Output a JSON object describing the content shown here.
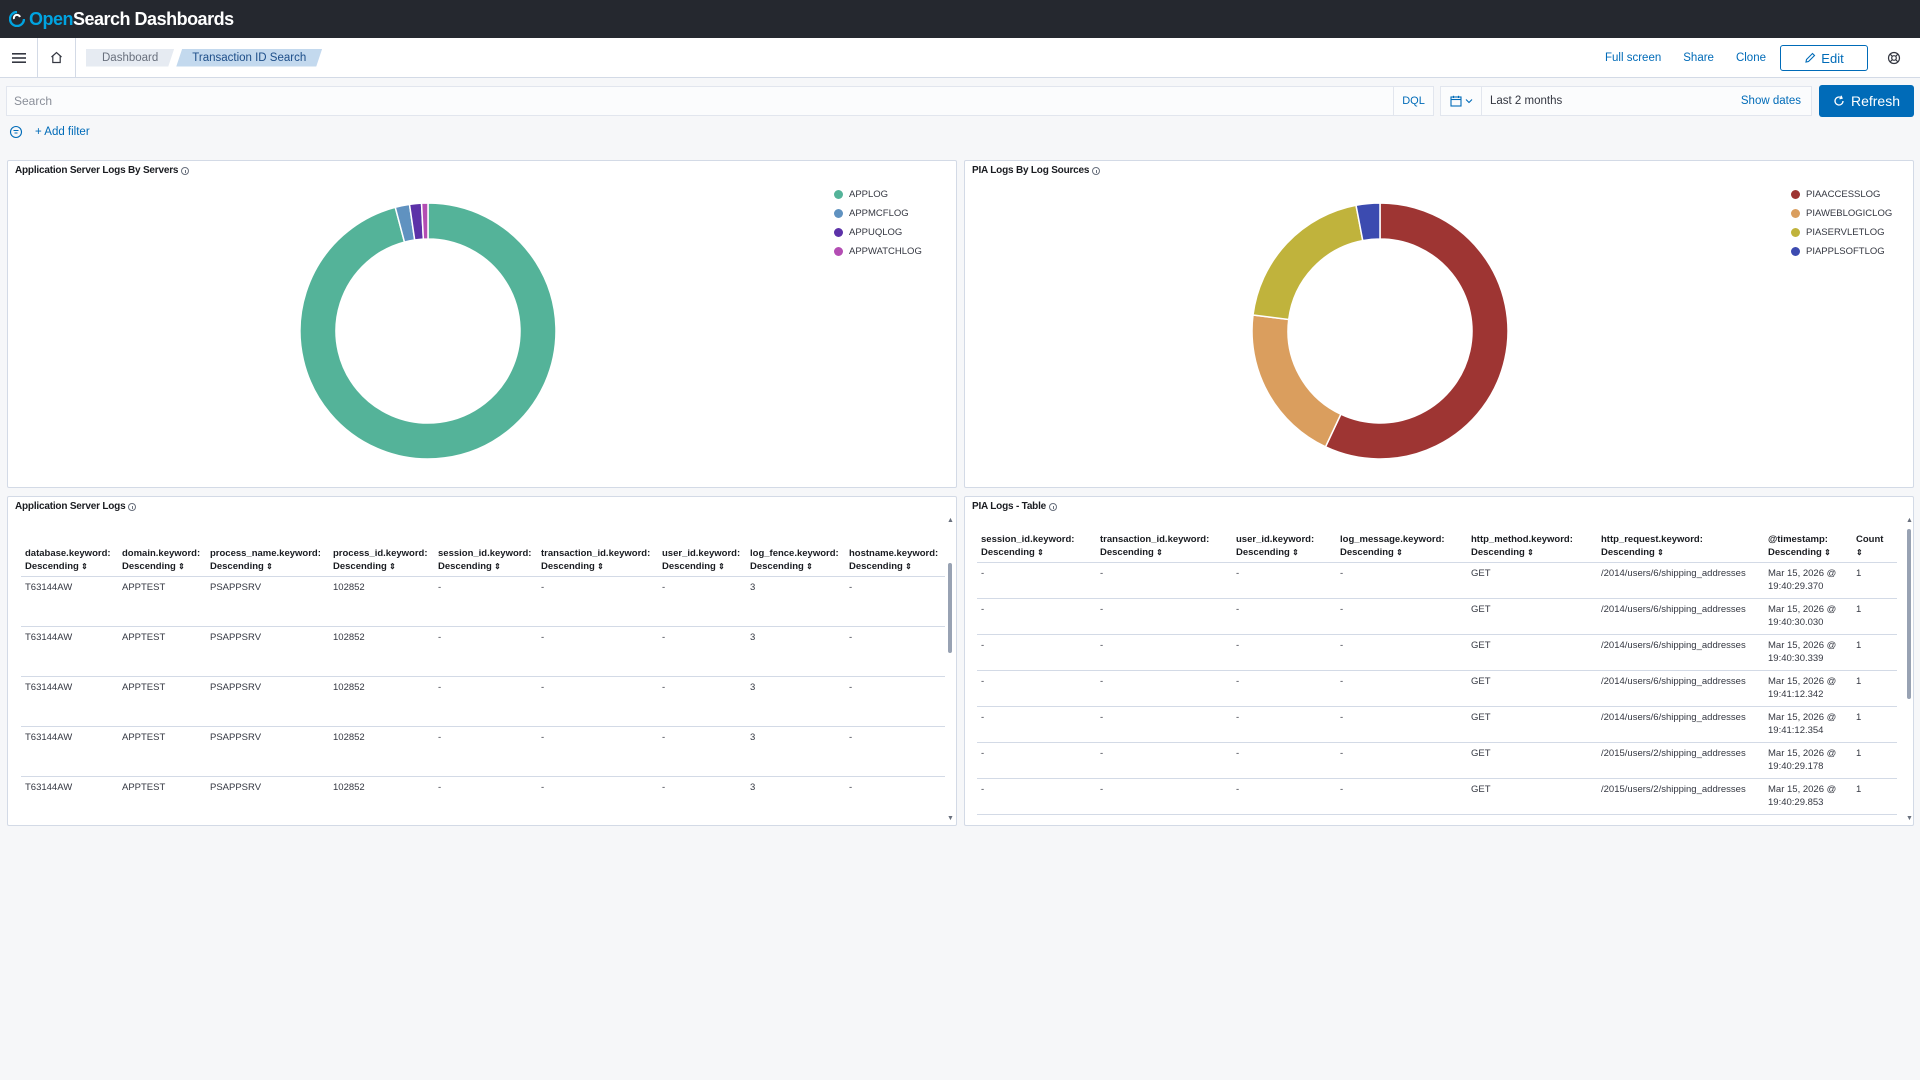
{
  "app": {
    "logo_open": "Open",
    "logo_rest": "Search Dashboards"
  },
  "breadcrumbs": [
    "Dashboard",
    "Transaction ID Search"
  ],
  "header_actions": {
    "fullscreen": "Full screen",
    "share": "Share",
    "clone": "Clone",
    "edit": "Edit"
  },
  "query": {
    "placeholder": "Search",
    "language": "DQL",
    "date_range": "Last 2 months",
    "show_dates": "Show dates",
    "refresh": "Refresh"
  },
  "filters": {
    "add_filter": "+ Add filter"
  },
  "panels": {
    "app_server_chart": {
      "title": "Application Server Logs By Servers",
      "legend": [
        {
          "label": "APPLOG",
          "color": "#54b399"
        },
        {
          "label": "APPMCFLOG",
          "color": "#6092c0"
        },
        {
          "label": "APPUQLOG",
          "color": "#5c32a8"
        },
        {
          "label": "APPWATCHLOG",
          "color": "#b34db3"
        }
      ]
    },
    "pia_chart": {
      "title": "PIA Logs By Log Sources",
      "legend": [
        {
          "label": "PIAACCESSLOG",
          "color": "#9e3533"
        },
        {
          "label": "PIAWEBLOGICLOG",
          "color": "#da9e5e"
        },
        {
          "label": "PIASERVLETLOG",
          "color": "#c0b33c"
        },
        {
          "label": "PIAPPLSOFTLOG",
          "color": "#3c4bb0"
        }
      ]
    },
    "app_server_table": {
      "title": "Application Server Logs",
      "columns": [
        [
          "database.keyword:",
          "Descending"
        ],
        [
          "domain.keyword:",
          "Descending"
        ],
        [
          "process_name.keyword:",
          "Descending"
        ],
        [
          "process_id.keyword:",
          "Descending"
        ],
        [
          "session_id.keyword:",
          "Descending"
        ],
        [
          "transaction_id.keyword:",
          "Descending"
        ],
        [
          "user_id.keyword:",
          "Descending"
        ],
        [
          "log_fence.keyword:",
          "Descending"
        ],
        [
          "hostname.keyword:",
          "Descending"
        ]
      ],
      "rows": [
        [
          "T63144AW",
          "APPTEST",
          "PSAPPSRV",
          "102852",
          "-",
          "-",
          "-",
          "3",
          "-"
        ],
        [
          "T63144AW",
          "APPTEST",
          "PSAPPSRV",
          "102852",
          "-",
          "-",
          "-",
          "3",
          "-"
        ],
        [
          "T63144AW",
          "APPTEST",
          "PSAPPSRV",
          "102852",
          "-",
          "-",
          "-",
          "3",
          "-"
        ],
        [
          "T63144AW",
          "APPTEST",
          "PSAPPSRV",
          "102852",
          "-",
          "-",
          "-",
          "3",
          "-"
        ],
        [
          "T63144AW",
          "APPTEST",
          "PSAPPSRV",
          "102852",
          "-",
          "-",
          "-",
          "3",
          "-"
        ]
      ]
    },
    "pia_table": {
      "title": "PIA Logs - Table",
      "columns": [
        [
          "session_id.keyword:",
          "Descending"
        ],
        [
          "transaction_id.keyword:",
          "Descending"
        ],
        [
          "user_id.keyword:",
          "Descending"
        ],
        [
          "log_message.keyword:",
          "Descending"
        ],
        [
          "http_method.keyword:",
          "Descending"
        ],
        [
          "http_request.keyword:",
          "Descending"
        ],
        [
          "@timestamp:",
          "Descending"
        ],
        [
          "Count",
          ""
        ]
      ],
      "rows": [
        [
          "-",
          "-",
          "-",
          "-",
          "GET",
          "/2014/users/6/shipping_addresses",
          "Mar 15, 2026 @",
          "19:40:29.370",
          "1"
        ],
        [
          "-",
          "-",
          "-",
          "-",
          "GET",
          "/2014/users/6/shipping_addresses",
          "Mar 15, 2026 @",
          "19:40:30.030",
          "1"
        ],
        [
          "-",
          "-",
          "-",
          "-",
          "GET",
          "/2014/users/6/shipping_addresses",
          "Mar 15, 2026 @",
          "19:40:30.339",
          "1"
        ],
        [
          "-",
          "-",
          "-",
          "-",
          "GET",
          "/2014/users/6/shipping_addresses",
          "Mar 15, 2026 @",
          "19:41:12.342",
          "1"
        ],
        [
          "-",
          "-",
          "-",
          "-",
          "GET",
          "/2014/users/6/shipping_addresses",
          "Mar 15, 2026 @",
          "19:41:12.354",
          "1"
        ],
        [
          "-",
          "-",
          "-",
          "-",
          "GET",
          "/2015/users/2/shipping_addresses",
          "Mar 15, 2026 @",
          "19:40:29.178",
          "1"
        ],
        [
          "-",
          "-",
          "-",
          "-",
          "GET",
          "/2015/users/2/shipping_addresses",
          "Mar 15, 2026 @",
          "19:40:29.853",
          "1"
        ]
      ]
    }
  },
  "chart_data": [
    {
      "type": "pie",
      "categories": [
        "APPLOG",
        "APPMCFLOG",
        "APPUQLOG",
        "APPWATCHLOG"
      ],
      "values": [
        95.5,
        1.8,
        1.5,
        0.8
      ],
      "colors": [
        "#54b399",
        "#6092c0",
        "#5c32a8",
        "#b34db3"
      ],
      "donut": true,
      "legend": "top-right"
    },
    {
      "type": "pie",
      "categories": [
        "PIAACCESSLOG",
        "PIAWEBLOGICLOG",
        "PIASERVLETLOG",
        "PIAPPLSOFTLOG"
      ],
      "values": [
        57,
        20,
        20,
        3
      ],
      "colors": [
        "#9e3533",
        "#da9e5e",
        "#c0b33c",
        "#3c4bb0"
      ],
      "donut": true,
      "legend": "top-right"
    }
  ]
}
